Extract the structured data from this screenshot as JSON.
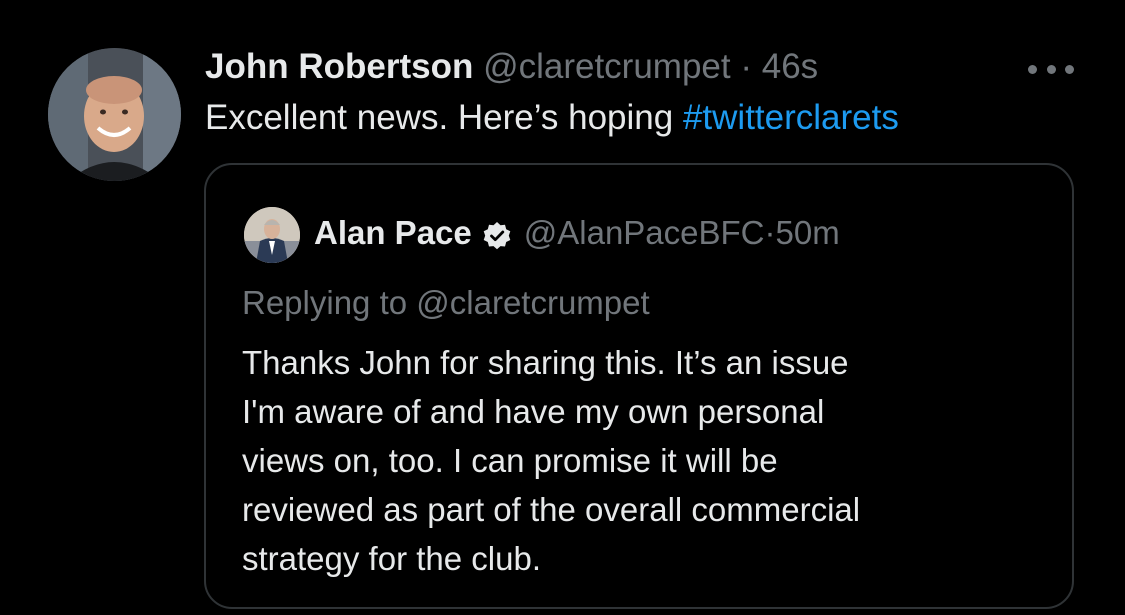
{
  "tweet": {
    "author": {
      "name": "John Robertson",
      "handle": "@claretcrumpet",
      "separator": "·",
      "time": "46s"
    },
    "text_prefix": "Excellent news. Here’s hoping ",
    "hashtag": "#twitterclarets",
    "more_icon": "more-horizontal-icon"
  },
  "quoted_tweet": {
    "author": {
      "name": "Alan Pace",
      "handle": "@AlanPaceBFC",
      "separator": "·",
      "time": "50m",
      "verified_icon": "verified-badge-icon"
    },
    "replying_to": "Replying to @claretcrumpet",
    "body_lines": [
      "Thanks John for sharing this. It’s an issue",
      "I'm aware of and have my own personal",
      "views on, too. I can promise it will be",
      "reviewed as part of the overall commercial",
      "strategy for the club."
    ]
  },
  "colors": {
    "background": "#000000",
    "text_primary": "#e7e9ea",
    "text_secondary": "#71767b",
    "link": "#1d9bf0",
    "border": "#2f3336"
  }
}
